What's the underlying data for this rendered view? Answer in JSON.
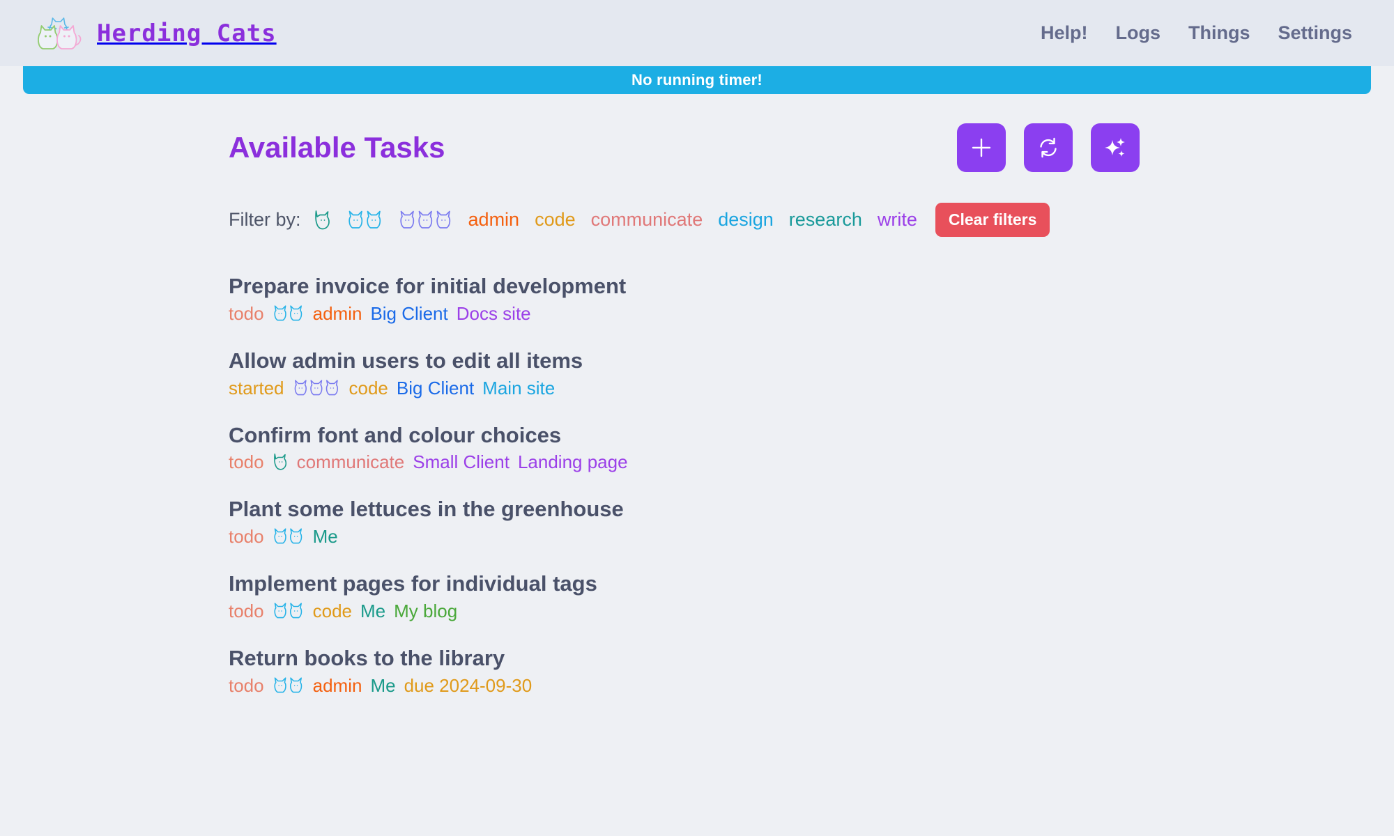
{
  "header": {
    "brand": {
      "title": "Herding Cats",
      "logo_icon": "three-cats-logo"
    },
    "nav": [
      {
        "label": "Help!",
        "name": "nav-help"
      },
      {
        "label": "Logs",
        "name": "nav-logs"
      },
      {
        "label": "Things",
        "name": "nav-things"
      },
      {
        "label": "Settings",
        "name": "nav-settings"
      }
    ]
  },
  "timer": {
    "text": "No running timer!",
    "background": "#1caee4"
  },
  "page": {
    "title": "Available Tasks",
    "title_color": "#8b2fdc"
  },
  "actions": [
    {
      "name": "add-task-button",
      "icon": "plus-icon",
      "label": "Add"
    },
    {
      "name": "refresh-button",
      "icon": "refresh-icon",
      "label": "Refresh"
    },
    {
      "name": "magic-button",
      "icon": "sparkles-icon",
      "label": "Magic"
    }
  ],
  "filters": {
    "label": "Filter by:",
    "priorities": [
      {
        "name": "filter-priority-1",
        "cats": 1,
        "color": "#1a9a8a"
      },
      {
        "name": "filter-priority-2",
        "cats": 2,
        "color": "#26b3e8"
      },
      {
        "name": "filter-priority-3",
        "cats": 3,
        "color": "#7b7bf0"
      }
    ],
    "tags": [
      {
        "label": "admin",
        "color": "#f4600f"
      },
      {
        "label": "code",
        "color": "#e09a1a"
      },
      {
        "label": "communicate",
        "color": "#e07878"
      },
      {
        "label": "design",
        "color": "#1aa5e0"
      },
      {
        "label": "research",
        "color": "#1a9a9a"
      },
      {
        "label": "write",
        "color": "#9b3fe8"
      }
    ],
    "clear_label": "Clear filters",
    "clear_color": "#e8505b"
  },
  "tasks": [
    {
      "title": "Prepare invoice for initial development",
      "status": {
        "label": "todo",
        "color": "#e8806a"
      },
      "cats": {
        "count": 2,
        "color": "#26b3e8"
      },
      "meta": [
        {
          "label": "admin",
          "color": "#f4600f"
        },
        {
          "label": "Big Client",
          "color": "#1a6ae8"
        },
        {
          "label": "Docs site",
          "color": "#9b3fe8"
        }
      ]
    },
    {
      "title": "Allow admin users to edit all items",
      "status": {
        "label": "started",
        "color": "#e09a1a"
      },
      "cats": {
        "count": 3,
        "color": "#7b7bf0"
      },
      "meta": [
        {
          "label": "code",
          "color": "#e09a1a"
        },
        {
          "label": "Big Client",
          "color": "#1a6ae8"
        },
        {
          "label": "Main site",
          "color": "#1aa5e0"
        }
      ]
    },
    {
      "title": "Confirm font and colour choices",
      "status": {
        "label": "todo",
        "color": "#e8806a"
      },
      "cats": {
        "count": 1,
        "color": "#1a9a8a"
      },
      "meta": [
        {
          "label": "communicate",
          "color": "#e07878"
        },
        {
          "label": "Small Client",
          "color": "#9b3fe8"
        },
        {
          "label": "Landing page",
          "color": "#9b3fe8"
        }
      ]
    },
    {
      "title": "Plant some lettuces in the greenhouse",
      "status": {
        "label": "todo",
        "color": "#e8806a"
      },
      "cats": {
        "count": 2,
        "color": "#26b3e8"
      },
      "meta": [
        {
          "label": "Me",
          "color": "#1a9a8a"
        }
      ]
    },
    {
      "title": "Implement pages for individual tags",
      "status": {
        "label": "todo",
        "color": "#e8806a"
      },
      "cats": {
        "count": 2,
        "color": "#26b3e8"
      },
      "meta": [
        {
          "label": "code",
          "color": "#e09a1a"
        },
        {
          "label": "Me",
          "color": "#1a9a8a"
        },
        {
          "label": "My blog",
          "color": "#4aa83a"
        }
      ]
    },
    {
      "title": "Return books to the library",
      "status": {
        "label": "todo",
        "color": "#e8806a"
      },
      "cats": {
        "count": 2,
        "color": "#26b3e8"
      },
      "meta": [
        {
          "label": "admin",
          "color": "#f4600f"
        },
        {
          "label": "Me",
          "color": "#1a9a8a"
        },
        {
          "label": "due 2024-09-30",
          "color": "#e09a1a"
        }
      ]
    }
  ]
}
